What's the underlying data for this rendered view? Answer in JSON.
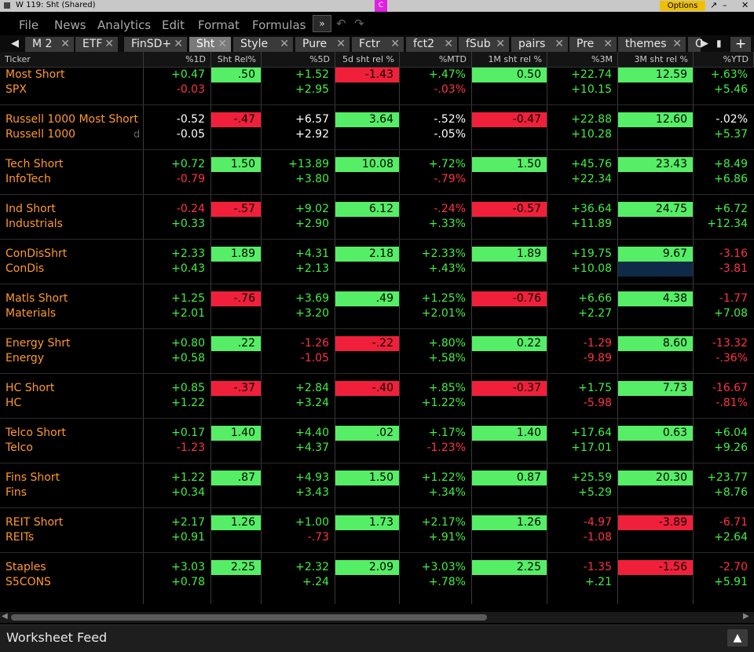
{
  "window": {
    "title": "W 119: Sht (Shared)",
    "c_button": "C",
    "options_label": "Options",
    "minimize": "↗",
    "restore": "–",
    "close": "✕"
  },
  "menu": {
    "items": [
      "File",
      "News",
      "Analytics",
      "Edit",
      "Format",
      "Formulas"
    ],
    "dropdown_icon": "»",
    "undo_icon": "↶",
    "redo_icon": "↷"
  },
  "tabs": {
    "left_arrow": "◀",
    "right_arrow": "▶",
    "add_label": "+",
    "items": [
      {
        "label": "M 2"
      },
      {
        "label": "ETF"
      },
      {
        "label": "FinSD+"
      },
      {
        "label": "Sht"
      },
      {
        "label": "Style"
      },
      {
        "label": "Pure"
      },
      {
        "label": "Fctr"
      },
      {
        "label": "fct2"
      },
      {
        "label": "fSub"
      },
      {
        "label": "pairs"
      },
      {
        "label": "Pre"
      },
      {
        "label": "themes"
      },
      {
        "label": "C"
      }
    ],
    "active": "Sht"
  },
  "columns": [
    "Ticker",
    "%1D",
    "Sht Rel%",
    "%5D",
    "5d sht rel %",
    "%MTD",
    "1M sht rel %",
    "%3M",
    "3M sht rel %",
    "%YTD"
  ],
  "rows": [
    {
      "ticker": "Most Short",
      "cells": [
        [
          "+0.47",
          "pos",
          ""
        ],
        [
          ".50",
          "",
          "pos"
        ],
        [
          "+1.52",
          "pos",
          ""
        ],
        [
          "-1.43",
          "",
          "neg"
        ],
        [
          "+.47%",
          "pos",
          ""
        ],
        [
          "0.50",
          "",
          "pos"
        ],
        [
          "+22.74",
          "pos",
          ""
        ],
        [
          "12.59",
          "",
          "pos"
        ],
        [
          "+.63%",
          "pos",
          ""
        ]
      ]
    },
    {
      "ticker": "SPX",
      "cells": [
        [
          "-0.03",
          "neg",
          ""
        ],
        [
          "",
          "",
          ""
        ],
        [
          "+2.95",
          "pos",
          ""
        ],
        [
          "",
          "",
          ""
        ],
        [
          "-.03%",
          "neg",
          ""
        ],
        [
          "",
          "",
          ""
        ],
        [
          "+10.15",
          "pos",
          ""
        ],
        [
          "",
          "",
          ""
        ],
        [
          "+5.46",
          "pos",
          ""
        ]
      ]
    },
    {
      "blank": true
    },
    {
      "ticker": "Russell 1000 Most Short",
      "cells": [
        [
          "-0.52",
          "neu",
          ""
        ],
        [
          "-.47",
          "",
          "neg"
        ],
        [
          "+6.57",
          "neu",
          ""
        ],
        [
          "3.64",
          "",
          "pos"
        ],
        [
          "-.52%",
          "neu",
          ""
        ],
        [
          "-0.47",
          "",
          "neg"
        ],
        [
          "+22.88",
          "pos",
          ""
        ],
        [
          "12.60",
          "",
          "pos"
        ],
        [
          "-.02%",
          "neu",
          ""
        ]
      ]
    },
    {
      "ticker": "Russell 1000",
      "suffix": "d",
      "cells": [
        [
          "-0.05",
          "neu",
          ""
        ],
        [
          "",
          "",
          ""
        ],
        [
          "+2.92",
          "neu",
          ""
        ],
        [
          "",
          "",
          ""
        ],
        [
          "-.05%",
          "neu",
          ""
        ],
        [
          "",
          "",
          ""
        ],
        [
          "+10.28",
          "pos",
          ""
        ],
        [
          "",
          "",
          ""
        ],
        [
          "+5.37",
          "pos",
          ""
        ]
      ]
    },
    {
      "blank": true
    },
    {
      "ticker": "Tech Short",
      "cells": [
        [
          "+0.72",
          "pos",
          ""
        ],
        [
          "1.50",
          "",
          "pos"
        ],
        [
          "+13.89",
          "pos",
          ""
        ],
        [
          "10.08",
          "",
          "pos"
        ],
        [
          "+.72%",
          "pos",
          ""
        ],
        [
          "1.50",
          "",
          "pos"
        ],
        [
          "+45.76",
          "pos",
          ""
        ],
        [
          "23.43",
          "",
          "pos"
        ],
        [
          "+8.49",
          "pos",
          ""
        ]
      ]
    },
    {
      "ticker": "InfoTech",
      "cells": [
        [
          "-0.79",
          "neg",
          ""
        ],
        [
          "",
          "",
          ""
        ],
        [
          "+3.80",
          "pos",
          ""
        ],
        [
          "",
          "",
          ""
        ],
        [
          "-.79%",
          "neg",
          ""
        ],
        [
          "",
          "",
          ""
        ],
        [
          "+22.34",
          "pos",
          ""
        ],
        [
          "",
          "",
          ""
        ],
        [
          "+6.86",
          "pos",
          ""
        ]
      ]
    },
    {
      "blank": true
    },
    {
      "ticker": "Ind Short",
      "cells": [
        [
          "-0.24",
          "neg",
          ""
        ],
        [
          "-.57",
          "",
          "neg"
        ],
        [
          "+9.02",
          "pos",
          ""
        ],
        [
          "6.12",
          "",
          "pos"
        ],
        [
          "-.24%",
          "neg",
          ""
        ],
        [
          "-0.57",
          "",
          "neg"
        ],
        [
          "+36.64",
          "pos",
          ""
        ],
        [
          "24.75",
          "",
          "pos"
        ],
        [
          "+6.72",
          "pos",
          ""
        ]
      ]
    },
    {
      "ticker": "Industrials",
      "cells": [
        [
          "+0.33",
          "pos",
          ""
        ],
        [
          "",
          "",
          ""
        ],
        [
          "+2.90",
          "pos",
          ""
        ],
        [
          "",
          "",
          ""
        ],
        [
          "+.33%",
          "pos",
          ""
        ],
        [
          "",
          "",
          ""
        ],
        [
          "+11.89",
          "pos",
          ""
        ],
        [
          "",
          "",
          ""
        ],
        [
          "+12.34",
          "pos",
          ""
        ]
      ]
    },
    {
      "blank": true
    },
    {
      "ticker": "ConDisShrt",
      "cells": [
        [
          "+2.33",
          "pos",
          ""
        ],
        [
          "1.89",
          "",
          "pos"
        ],
        [
          "+4.31",
          "pos",
          ""
        ],
        [
          "2.18",
          "",
          "pos"
        ],
        [
          "+2.33%",
          "pos",
          ""
        ],
        [
          "1.89",
          "",
          "pos"
        ],
        [
          "+19.75",
          "pos",
          ""
        ],
        [
          "9.67",
          "",
          "pos"
        ],
        [
          "-3.16",
          "neg",
          ""
        ]
      ]
    },
    {
      "ticker": "ConDis",
      "cells": [
        [
          "+0.43",
          "pos",
          ""
        ],
        [
          "",
          "",
          ""
        ],
        [
          "+2.13",
          "pos",
          ""
        ],
        [
          "",
          "",
          ""
        ],
        [
          "+.43%",
          "pos",
          ""
        ],
        [
          "",
          "",
          ""
        ],
        [
          "+10.08",
          "pos",
          ""
        ],
        [
          "",
          "",
          "blue"
        ],
        [
          "-3.81",
          "neg",
          ""
        ]
      ]
    },
    {
      "blank": true
    },
    {
      "ticker": "Matls Short",
      "cells": [
        [
          "+1.25",
          "pos",
          ""
        ],
        [
          "-.76",
          "",
          "neg"
        ],
        [
          "+3.69",
          "pos",
          ""
        ],
        [
          ".49",
          "",
          "pos"
        ],
        [
          "+1.25%",
          "pos",
          ""
        ],
        [
          "-0.76",
          "",
          "neg"
        ],
        [
          "+6.66",
          "pos",
          ""
        ],
        [
          "4.38",
          "",
          "pos"
        ],
        [
          "-1.77",
          "neg",
          ""
        ]
      ]
    },
    {
      "ticker": "Materials",
      "cells": [
        [
          "+2.01",
          "pos",
          ""
        ],
        [
          "",
          "",
          ""
        ],
        [
          "+3.20",
          "pos",
          ""
        ],
        [
          "",
          "",
          ""
        ],
        [
          "+2.01%",
          "pos",
          ""
        ],
        [
          "",
          "",
          ""
        ],
        [
          "+2.27",
          "pos",
          ""
        ],
        [
          "",
          "",
          ""
        ],
        [
          "+7.08",
          "pos",
          ""
        ]
      ]
    },
    {
      "blank": true
    },
    {
      "ticker": "Energy Shrt",
      "cells": [
        [
          "+0.80",
          "pos",
          ""
        ],
        [
          ".22",
          "",
          "pos"
        ],
        [
          "-1.26",
          "neg",
          ""
        ],
        [
          "-.22",
          "",
          "neg"
        ],
        [
          "+.80%",
          "pos",
          ""
        ],
        [
          "0.22",
          "",
          "pos"
        ],
        [
          "-1.29",
          "neg",
          ""
        ],
        [
          "8.60",
          "",
          "pos"
        ],
        [
          "-13.32",
          "neg",
          ""
        ]
      ]
    },
    {
      "ticker": "Energy",
      "cells": [
        [
          "+0.58",
          "pos",
          ""
        ],
        [
          "",
          "",
          ""
        ],
        [
          "-1.05",
          "neg",
          ""
        ],
        [
          "",
          "",
          ""
        ],
        [
          "+.58%",
          "pos",
          ""
        ],
        [
          "",
          "",
          ""
        ],
        [
          "-9.89",
          "neg",
          ""
        ],
        [
          "",
          "",
          ""
        ],
        [
          "-.36%",
          "neg",
          ""
        ]
      ]
    },
    {
      "blank": true
    },
    {
      "ticker": "HC Short",
      "cells": [
        [
          "+0.85",
          "pos",
          ""
        ],
        [
          "-.37",
          "",
          "neg"
        ],
        [
          "+2.84",
          "pos",
          ""
        ],
        [
          "-.40",
          "",
          "neg"
        ],
        [
          "+.85%",
          "pos",
          ""
        ],
        [
          "-0.37",
          "",
          "neg"
        ],
        [
          "+1.75",
          "pos",
          ""
        ],
        [
          "7.73",
          "",
          "pos"
        ],
        [
          "-16.67",
          "neg",
          ""
        ]
      ]
    },
    {
      "ticker": "HC",
      "cells": [
        [
          "+1.22",
          "pos",
          ""
        ],
        [
          "",
          "",
          ""
        ],
        [
          "+3.24",
          "pos",
          ""
        ],
        [
          "",
          "",
          ""
        ],
        [
          "+1.22%",
          "pos",
          ""
        ],
        [
          "",
          "",
          ""
        ],
        [
          "-5.98",
          "neg",
          ""
        ],
        [
          "",
          "",
          ""
        ],
        [
          "-.81%",
          "neg",
          ""
        ]
      ]
    },
    {
      "blank": true
    },
    {
      "ticker": "Telco Short",
      "cells": [
        [
          "+0.17",
          "pos",
          ""
        ],
        [
          "1.40",
          "",
          "pos"
        ],
        [
          "+4.40",
          "pos",
          ""
        ],
        [
          ".02",
          "",
          "pos"
        ],
        [
          "+.17%",
          "pos",
          ""
        ],
        [
          "1.40",
          "",
          "pos"
        ],
        [
          "+17.64",
          "pos",
          ""
        ],
        [
          "0.63",
          "",
          "pos"
        ],
        [
          "+6.04",
          "pos",
          ""
        ]
      ]
    },
    {
      "ticker": "Telco",
      "cells": [
        [
          "-1.23",
          "neg",
          ""
        ],
        [
          "",
          "",
          ""
        ],
        [
          "+4.37",
          "pos",
          ""
        ],
        [
          "",
          "",
          ""
        ],
        [
          "-1.23%",
          "neg",
          ""
        ],
        [
          "",
          "",
          ""
        ],
        [
          "+17.01",
          "pos",
          ""
        ],
        [
          "",
          "",
          ""
        ],
        [
          "+9.26",
          "pos",
          ""
        ]
      ]
    },
    {
      "blank": true
    },
    {
      "ticker": "Fins Short",
      "cells": [
        [
          "+1.22",
          "pos",
          ""
        ],
        [
          ".87",
          "",
          "pos"
        ],
        [
          "+4.93",
          "pos",
          ""
        ],
        [
          "1.50",
          "",
          "pos"
        ],
        [
          "+1.22%",
          "pos",
          ""
        ],
        [
          "0.87",
          "",
          "pos"
        ],
        [
          "+25.59",
          "pos",
          ""
        ],
        [
          "20.30",
          "",
          "pos"
        ],
        [
          "+23.77",
          "pos",
          ""
        ]
      ]
    },
    {
      "ticker": "Fins",
      "cells": [
        [
          "+0.34",
          "pos",
          ""
        ],
        [
          "",
          "",
          ""
        ],
        [
          "+3.43",
          "pos",
          ""
        ],
        [
          "",
          "",
          ""
        ],
        [
          "+.34%",
          "pos",
          ""
        ],
        [
          "",
          "",
          ""
        ],
        [
          "+5.29",
          "pos",
          ""
        ],
        [
          "",
          "",
          ""
        ],
        [
          "+8.76",
          "pos",
          ""
        ]
      ]
    },
    {
      "blank": true
    },
    {
      "ticker": "REIT Short",
      "cells": [
        [
          "+2.17",
          "pos",
          ""
        ],
        [
          "1.26",
          "",
          "pos"
        ],
        [
          "+1.00",
          "pos",
          ""
        ],
        [
          "1.73",
          "",
          "pos"
        ],
        [
          "+2.17%",
          "pos",
          ""
        ],
        [
          "1.26",
          "",
          "pos"
        ],
        [
          "-4.97",
          "neg",
          ""
        ],
        [
          "-3.89",
          "",
          "neg"
        ],
        [
          "-6.71",
          "neg",
          ""
        ]
      ]
    },
    {
      "ticker": "REITs",
      "cells": [
        [
          "+0.91",
          "pos",
          ""
        ],
        [
          "",
          "",
          ""
        ],
        [
          "-.73",
          "neg",
          ""
        ],
        [
          "",
          "",
          ""
        ],
        [
          "+.91%",
          "pos",
          ""
        ],
        [
          "",
          "",
          ""
        ],
        [
          "-1.08",
          "neg",
          ""
        ],
        [
          "",
          "",
          ""
        ],
        [
          "+2.64",
          "pos",
          ""
        ]
      ]
    },
    {
      "blank": true
    },
    {
      "ticker": "Staples",
      "cells": [
        [
          "+3.03",
          "pos",
          ""
        ],
        [
          "2.25",
          "",
          "pos"
        ],
        [
          "+2.32",
          "pos",
          ""
        ],
        [
          "2.09",
          "",
          "pos"
        ],
        [
          "+3.03%",
          "pos",
          ""
        ],
        [
          "2.25",
          "",
          "pos"
        ],
        [
          "-1.35",
          "neg",
          ""
        ],
        [
          "-1.56",
          "",
          "neg"
        ],
        [
          "-2.70",
          "neg",
          ""
        ]
      ]
    },
    {
      "ticker": "S5CONS",
      "cells": [
        [
          "+0.78",
          "pos",
          ""
        ],
        [
          "",
          "",
          ""
        ],
        [
          "+.24",
          "pos",
          ""
        ],
        [
          "",
          "",
          ""
        ],
        [
          "+.78%",
          "pos",
          ""
        ],
        [
          "",
          "",
          ""
        ],
        [
          "+.21",
          "pos",
          ""
        ],
        [
          "",
          "",
          ""
        ],
        [
          "+5.91",
          "pos",
          ""
        ]
      ]
    }
  ],
  "footer": {
    "title": "Worksheet Feed",
    "expand_icon": "▲"
  },
  "scrollbar": {
    "left": "◀",
    "right": "▶"
  },
  "colors": {
    "up_bg": "#55ee66",
    "down_bg": "#f0203a",
    "up_text": "#44ee44",
    "down_text": "#ff3344",
    "ticker_text": "#ff9a2a",
    "options_bg": "#f0c000"
  }
}
